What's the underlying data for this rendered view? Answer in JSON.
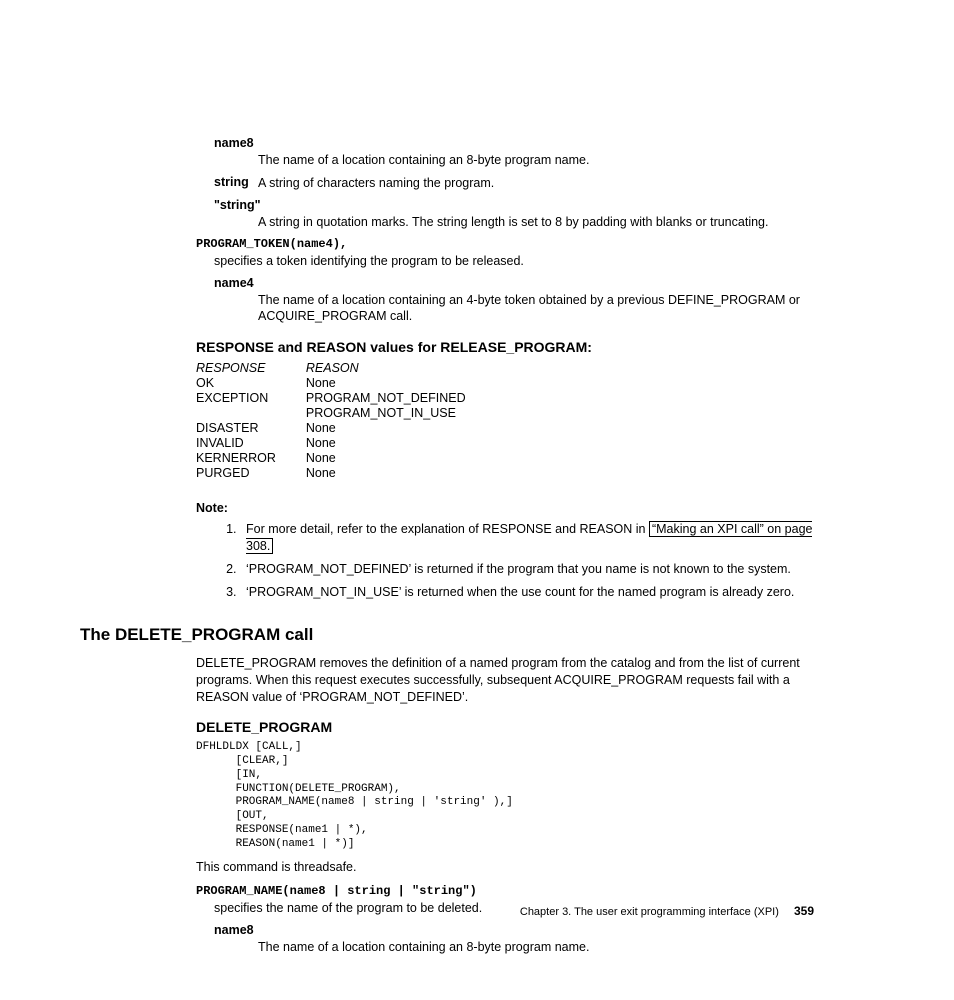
{
  "defs": {
    "name8_t": "name8",
    "name8_d": "The name of a location containing an 8-byte program name.",
    "string_t": "string",
    "string_d": "A string of characters naming the program.",
    "qstring_t": "\"string\"",
    "qstring_d": "A string in quotation marks. The string length is set to 8 by padding with blanks or truncating.",
    "progtok_t": "PROGRAM_TOKEN(name4),",
    "progtok_d": "specifies a token identifying the program to be released.",
    "name4_t": "name4",
    "name4_d": "The name of a location containing an 4-byte token obtained by a previous DEFINE_PROGRAM or ACQUIRE_PROGRAM call."
  },
  "rr_heading": "RESPONSE and REASON values for RELEASE_PROGRAM:",
  "rr_table": {
    "h1": "RESPONSE",
    "h2": "REASON",
    "rows": [
      {
        "c1": "OK",
        "c2": "None"
      },
      {
        "c1": "EXCEPTION",
        "c2": "PROGRAM_NOT_DEFINED"
      },
      {
        "c1": "",
        "c2": "PROGRAM_NOT_IN_USE"
      },
      {
        "c1": "DISASTER",
        "c2": "None"
      },
      {
        "c1": "INVALID",
        "c2": "None"
      },
      {
        "c1": "KERNERROR",
        "c2": "None"
      },
      {
        "c1": "PURGED",
        "c2": "None"
      }
    ]
  },
  "note_h": "Note:",
  "notes": {
    "n1a": "For more detail, refer to the explanation of RESPONSE and REASON in ",
    "n1link": "“Making an XPI call” on page 308.",
    "n2": "‘PROGRAM_NOT_DEFINED’ is returned if the program that you name is not known to the system.",
    "n3": "‘PROGRAM_NOT_IN_USE’ is returned when the use count for the named program is already zero."
  },
  "h2_delete": "The DELETE_PROGRAM call",
  "delete_intro": "DELETE_PROGRAM removes the definition of a named program from the catalog and from the list of current programs. When this request executes successfully, subsequent ACQUIRE_PROGRAM requests fail with a REASON value of ‘PROGRAM_NOT_DEFINED’.",
  "h3_delete": "DELETE_PROGRAM",
  "code_block": "DFHLDLDX [CALL,]\n      [CLEAR,]\n      [IN,\n      FUNCTION(DELETE_PROGRAM),\n      PROGRAM_NAME(name8 | string | 'string' ),]\n      [OUT,\n      RESPONSE(name1 | *),\n      REASON(name1 | *)]",
  "threadsafe": "This command is threadsafe.",
  "progname_t": "PROGRAM_NAME(name8 | string | \"string\")",
  "progname_d": "specifies the name of the program to be deleted.",
  "name8b_t": "name8",
  "name8b_d": "The name of a location containing an 8-byte program name.",
  "footer_chapter": "Chapter 3. The user exit programming interface (XPI)",
  "footer_page": "359"
}
